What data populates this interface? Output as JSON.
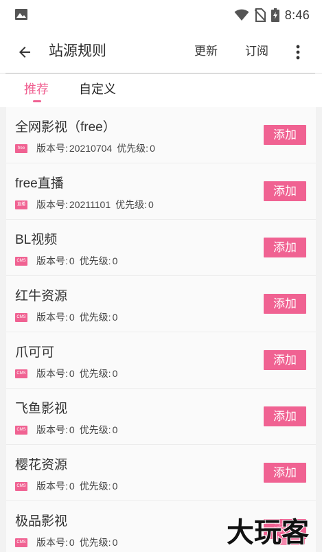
{
  "status_bar": {
    "time": "8:46",
    "icons": [
      "gallery-icon",
      "wifi-icon",
      "no-sim-icon",
      "battery-charging-icon"
    ]
  },
  "app_bar": {
    "title": "站源规则",
    "actions": {
      "update": "更新",
      "subscribe": "订阅"
    },
    "icons": [
      "back-arrow-icon",
      "more-vert-icon"
    ]
  },
  "tabs": {
    "recommended": "推荐",
    "custom": "自定义",
    "active": "recommended"
  },
  "list": {
    "version_label": "版本号:",
    "priority_label": "优先级:",
    "add_label": "添加",
    "items": [
      {
        "name": "全网影视（free）",
        "tag": "free",
        "version": "20210704",
        "priority": "0"
      },
      {
        "name": "free直播",
        "tag": "直播",
        "version": "20211101",
        "priority": "0"
      },
      {
        "name": "BL视频",
        "tag": "CMS",
        "version": "0",
        "priority": "0"
      },
      {
        "name": "红牛资源",
        "tag": "CMS",
        "version": "0",
        "priority": "0"
      },
      {
        "name": "爪可可",
        "tag": "CMS",
        "version": "0",
        "priority": "0"
      },
      {
        "name": "飞鱼影视",
        "tag": "CMS",
        "version": "0",
        "priority": "0"
      },
      {
        "name": "樱花资源",
        "tag": "CMS",
        "version": "0",
        "priority": "0"
      },
      {
        "name": "极品影视",
        "tag": "CMS",
        "version": "0",
        "priority": "0"
      }
    ]
  },
  "watermark": {
    "text": "大玩客"
  },
  "colors": {
    "accent": "#f06292",
    "background": "#f2f2f2",
    "row_background": "#fafafa",
    "text_primary": "#333333"
  }
}
